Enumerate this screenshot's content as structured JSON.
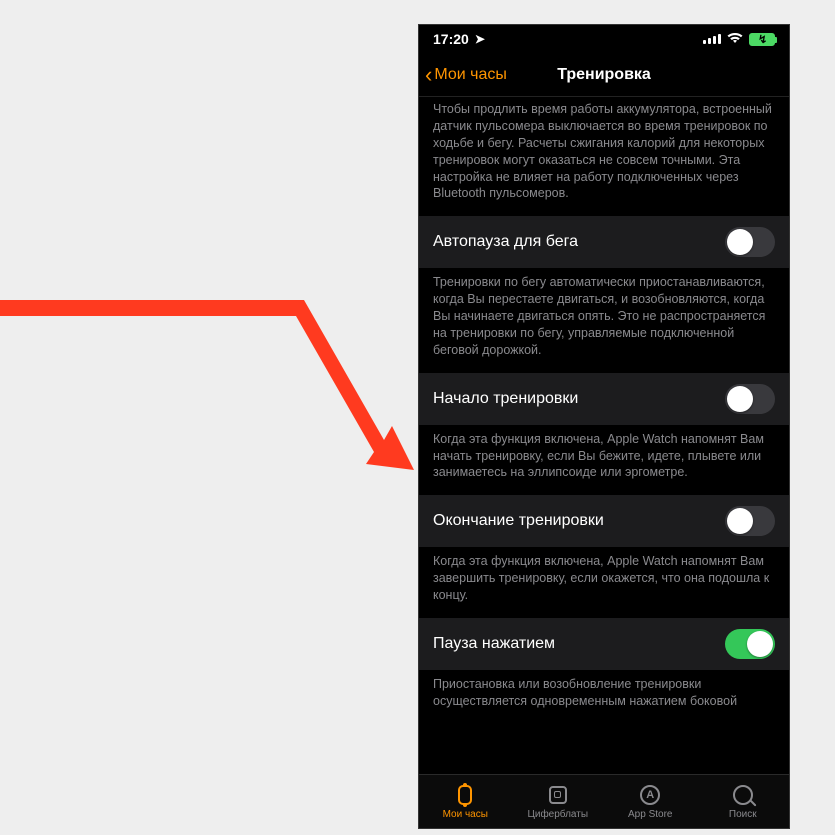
{
  "status": {
    "time": "17:20",
    "location_icon": "location-arrow"
  },
  "nav": {
    "back_label": "Мои часы",
    "title": "Тренировка"
  },
  "sections": [
    {
      "intro": "Чтобы продлить время работы аккумулятора, встроенный датчик пульсомера выключается во время тренировок по ходьбе и бегу. Расчеты сжигания калорий для некоторых тренировок могут оказаться не совсем точными. Эта настройка не влияет на работу подключенных через Bluetooth пульсомеров.",
      "label": "Автопауза для бега",
      "on": false,
      "footer": "Тренировки по бегу автоматически приостанавливаются, когда Вы перестаете двигаться, и возобновляются, когда Вы начинаете двигаться опять. Это не распространяется на тренировки по бегу, управляемые подключенной беговой дорожкой."
    },
    {
      "label": "Начало тренировки",
      "on": false,
      "footer": "Когда эта функция включена, Apple Watch напомнят Вам начать тренировку, если Вы бежите, идете, плывете или занимаетесь на эллипсоиде или эргометре."
    },
    {
      "label": "Окончание тренировки",
      "on": false,
      "footer": "Когда эта функция включена, Apple Watch напомнят Вам завершить тренировку, если окажется, что она подошла к концу."
    },
    {
      "label": "Пауза нажатием",
      "on": true,
      "footer": "Приостановка или возобновление тренировки осуществляется одновременным нажатием боковой"
    }
  ],
  "tabs": [
    {
      "label": "Мои часы",
      "icon": "watch",
      "active": true
    },
    {
      "label": "Циферблаты",
      "icon": "faces",
      "active": false
    },
    {
      "label": "App Store",
      "icon": "appstore",
      "active": false
    },
    {
      "label": "Поиск",
      "icon": "search",
      "active": false
    }
  ]
}
